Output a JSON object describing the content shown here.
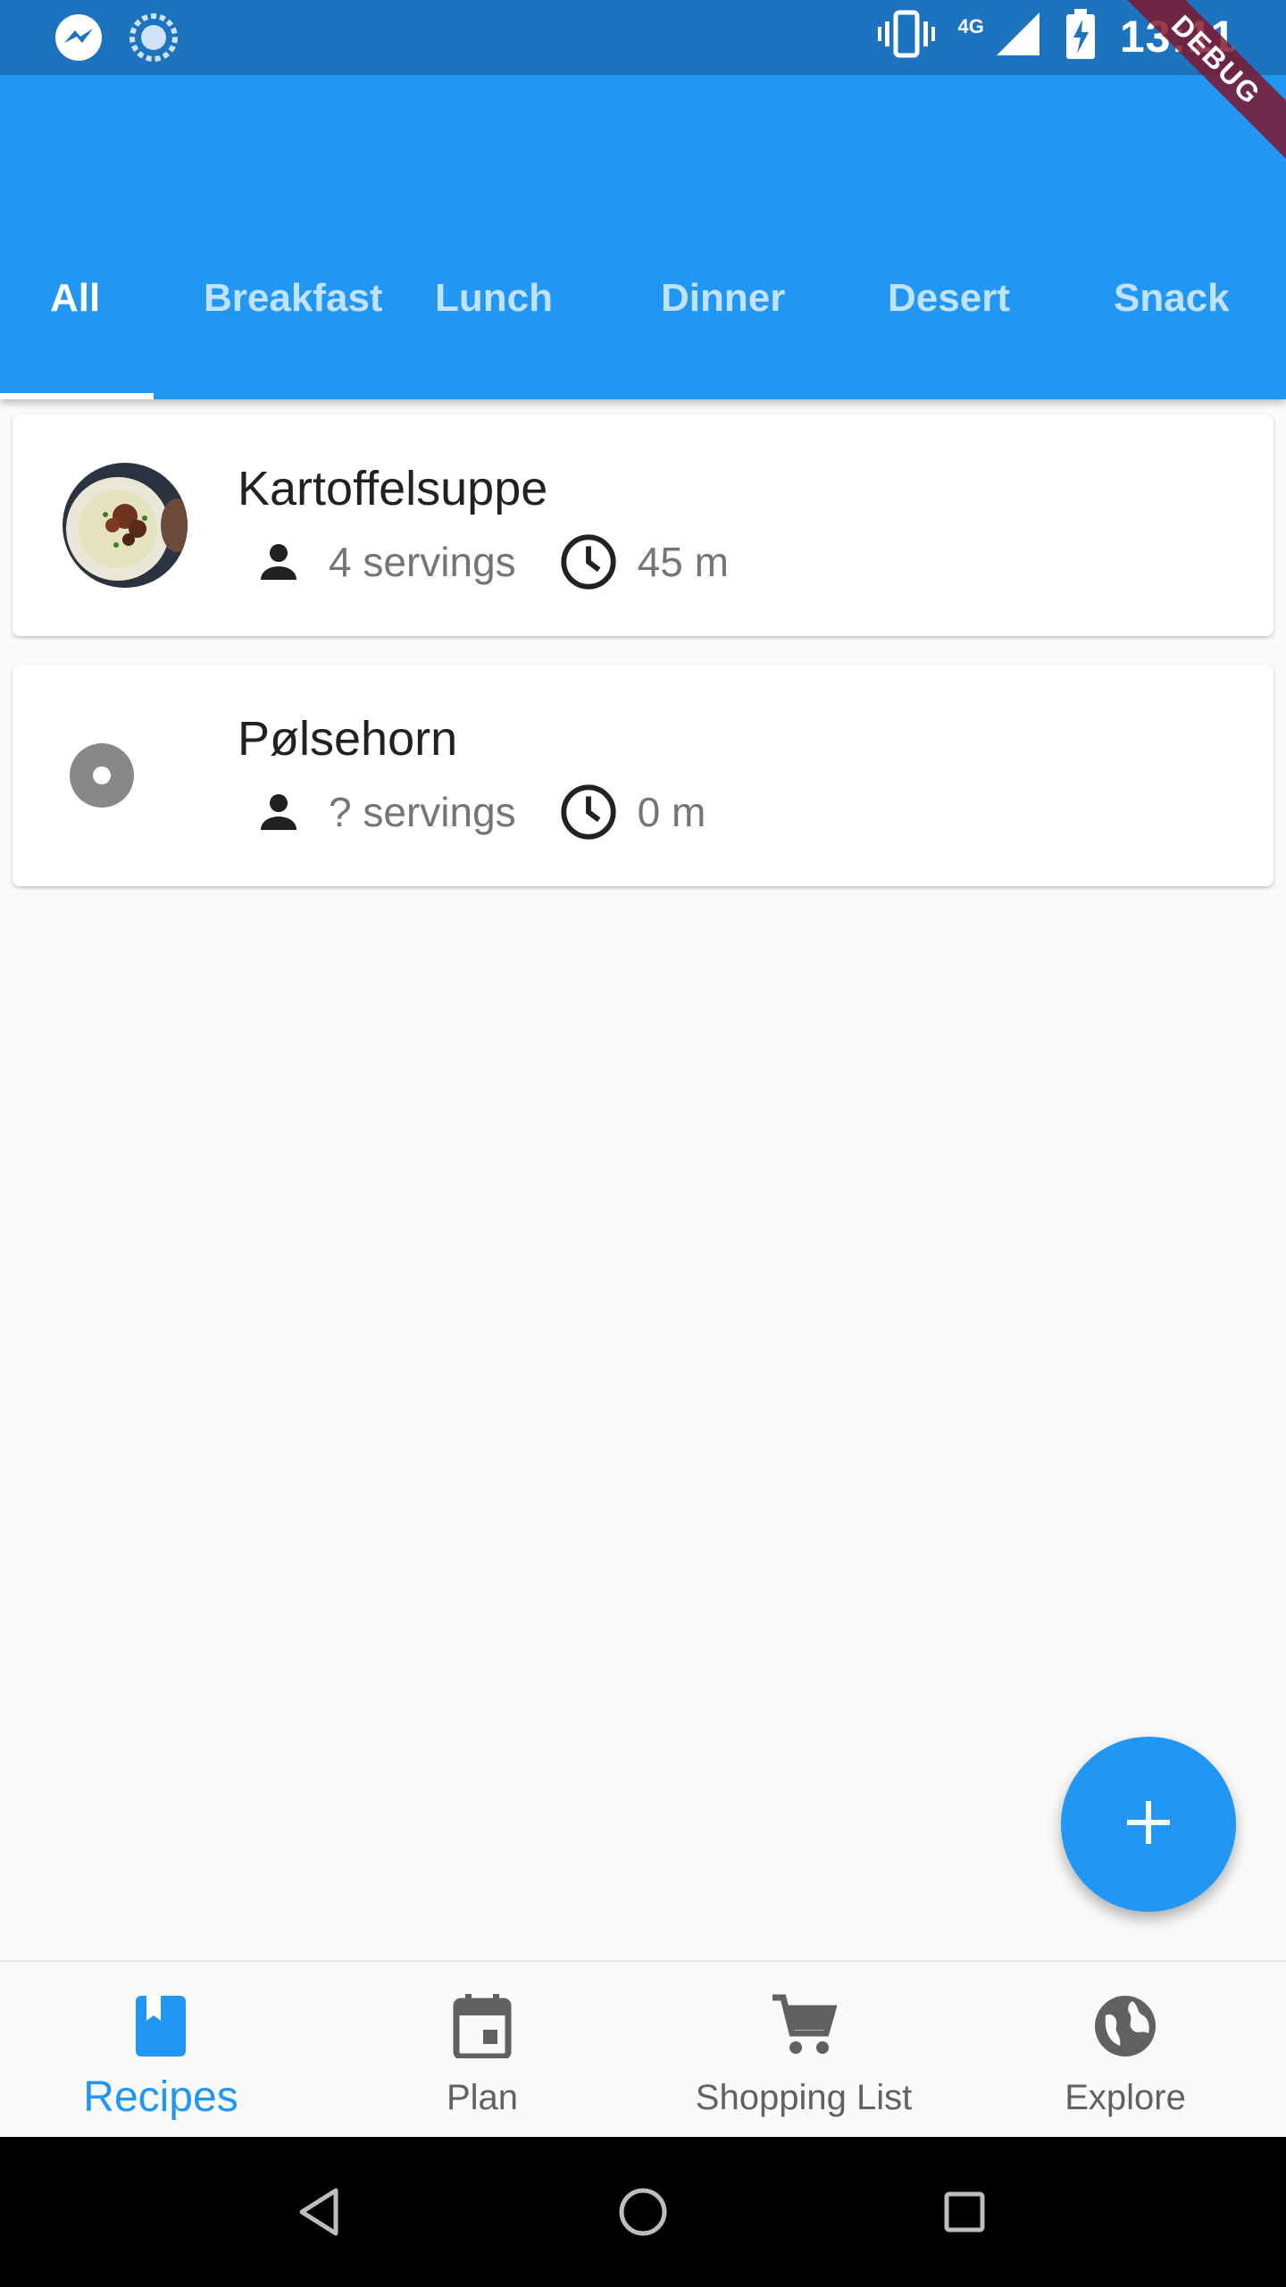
{
  "status_bar": {
    "time": "13:11",
    "network": "4G",
    "left_icons": [
      "messenger-icon",
      "sync-icon"
    ],
    "right_icons": [
      "vibrate-icon",
      "signal-icon",
      "battery-charging-icon"
    ]
  },
  "debug_banner": "DEBUG",
  "tabs": [
    {
      "label": "All",
      "active": true
    },
    {
      "label": "Breakfast"
    },
    {
      "label": "Lunch"
    },
    {
      "label": "Dinner"
    },
    {
      "label": "Desert"
    },
    {
      "label": "Snack"
    }
  ],
  "recipes": [
    {
      "title": "Kartoffelsuppe",
      "servings": "4 servings",
      "time": "45 m",
      "thumbnail": "soup-photo"
    },
    {
      "title": "Pølsehorn",
      "servings": "? servings",
      "time": "0 m",
      "thumbnail": "placeholder-disc-icon"
    }
  ],
  "fab": {
    "icon": "add-icon"
  },
  "bottom_nav": [
    {
      "label": "Recipes",
      "icon": "book-icon",
      "active": true
    },
    {
      "label": "Plan",
      "icon": "calendar-icon"
    },
    {
      "label": "Shopping List",
      "icon": "shopping-cart-icon"
    },
    {
      "label": "Explore",
      "icon": "globe-icon"
    }
  ],
  "colors": {
    "primary": "#2196f3",
    "status_bar": "#1e73be",
    "background": "#fafafa",
    "inactive_nav": "#616161",
    "debug_ribbon": "#7f1428"
  }
}
